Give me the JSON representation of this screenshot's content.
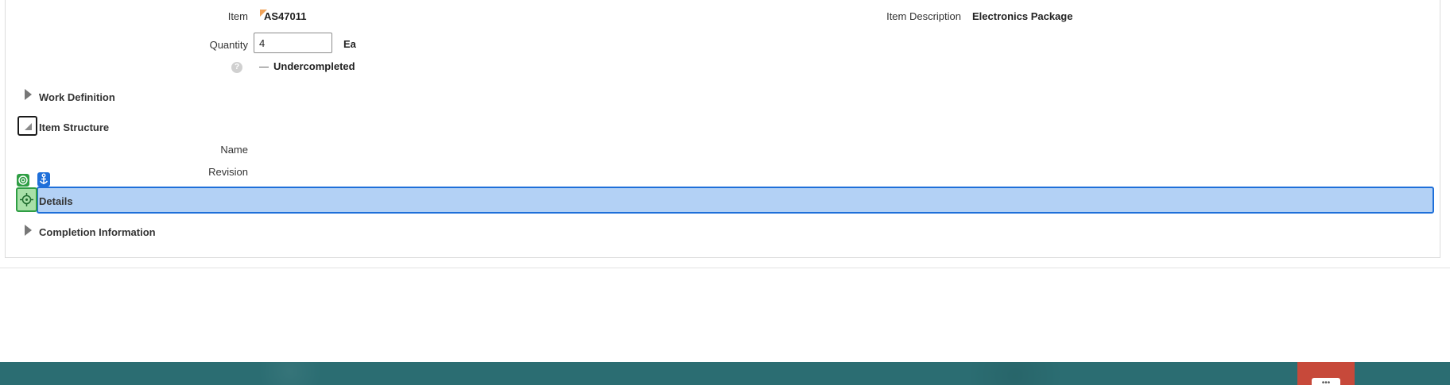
{
  "header": {
    "item_label": "Item",
    "item_value": "AS47011",
    "item_description_label": "Item Description",
    "item_description_value": "Electronics Package",
    "quantity_label": "Quantity",
    "quantity_value": "4",
    "quantity_uom": "Ea",
    "help_glyph": "?",
    "status_value": "Undercompleted"
  },
  "sections": {
    "work_definition": "Work Definition",
    "item_structure": "Item Structure",
    "details": "Details",
    "completion_information": "Completion Information"
  },
  "item_structure": {
    "name_label": "Name",
    "revision_label": "Revision"
  },
  "overlay_icons": {
    "target": "target-icon",
    "anchor": "anchor-icon",
    "crosshair": "crosshair-icon"
  },
  "footer": {
    "chip_glyph": "•••"
  },
  "colors": {
    "details_highlight": "#b3d1f5",
    "details_border": "#1e6fd9",
    "overlay_green": "#2f9e44",
    "overlay_blue": "#1e6fd9",
    "footer_teal": "#2b6d72",
    "footer_red": "#c7493a",
    "item_flag": "#f0a35a"
  }
}
